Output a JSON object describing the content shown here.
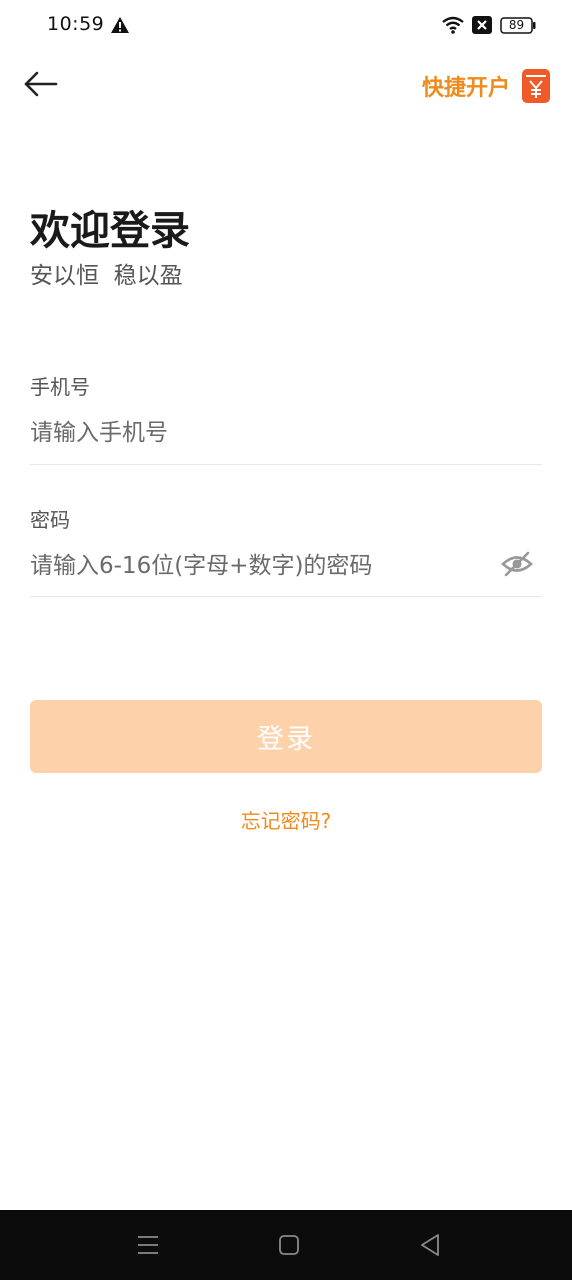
{
  "status_bar": {
    "time": "10:59",
    "battery": "89",
    "icons": [
      "warning-icon",
      "wifi-icon",
      "sim-no-signal-icon",
      "battery-icon"
    ]
  },
  "header": {
    "back_icon": "arrow-left-icon",
    "quick_open_label": "快捷开户",
    "quick_open_icon": "yen-wallet-icon"
  },
  "welcome": {
    "title": "欢迎登录",
    "subtitle": "安以恒  稳以盈"
  },
  "form": {
    "phone": {
      "label": "手机号",
      "placeholder": "请输入手机号",
      "value": ""
    },
    "password": {
      "label": "密码",
      "placeholder": "请输入6-16位(字母+数字)的密码",
      "value": "",
      "toggle_icon": "eye-off-icon"
    },
    "login_label": "登录",
    "forgot_label": "忘记密码?"
  },
  "nav_bar": {
    "icons": [
      "menu-icon",
      "home-square-icon",
      "back-triangle-icon"
    ]
  },
  "colors": {
    "accent": "#ef8a1c",
    "accent_light": "#fdd2ab",
    "nav_bg": "#0c0c0c"
  }
}
